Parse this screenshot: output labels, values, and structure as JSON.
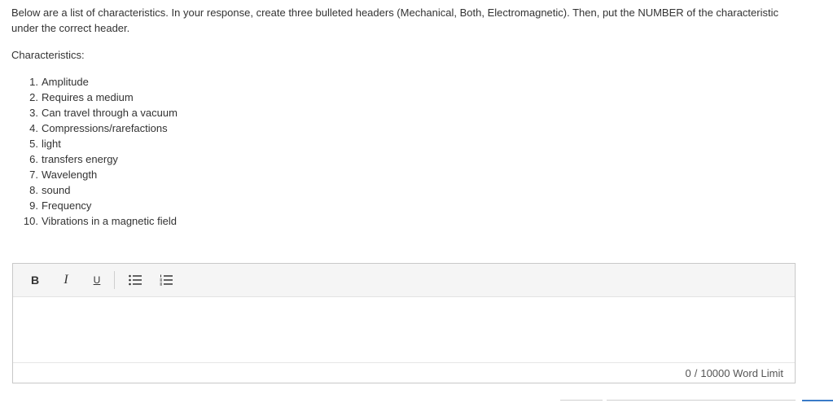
{
  "prompt": {
    "text": "Below are a list of characteristics. In your response, create three bulleted headers (Mechanical, Both, Electromagnetic). Then, put the NUMBER of the characteristic under the correct header."
  },
  "characteristics": {
    "heading": "Characteristics:",
    "items": [
      {
        "num": "1.",
        "label": "Amplitude"
      },
      {
        "num": "2.",
        "label": "Requires a medium"
      },
      {
        "num": "3.",
        "label": "Can travel through a vacuum"
      },
      {
        "num": "4.",
        "label": "Compressions/rarefactions"
      },
      {
        "num": "5.",
        "label": "light"
      },
      {
        "num": "6.",
        "label": "transfers energy"
      },
      {
        "num": "7.",
        "label": "Wavelength"
      },
      {
        "num": "8.",
        "label": "sound"
      },
      {
        "num": "9.",
        "label": "Frequency"
      },
      {
        "num": "10.",
        "label": "Vibrations in a magnetic field"
      }
    ]
  },
  "editor": {
    "toolbar": {
      "bold": "B",
      "italic": "I",
      "underline": "U",
      "bullet_list_icon": "bullet-list-icon",
      "numbered_list_icon": "numbered-list-icon"
    },
    "content": "",
    "word_count": "0",
    "separator": "/",
    "word_limit": "10000 Word Limit"
  }
}
